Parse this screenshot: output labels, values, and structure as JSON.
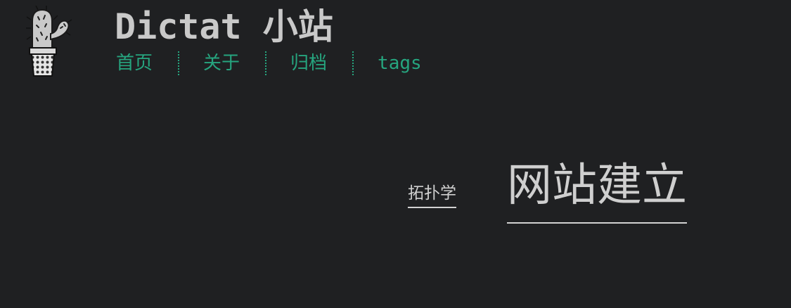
{
  "header": {
    "logo_icon": "cactus-pot-icon",
    "title": "Dictat 小站"
  },
  "nav": {
    "items": [
      {
        "label": "首页"
      },
      {
        "label": "关于"
      },
      {
        "label": "归档"
      },
      {
        "label": "tags"
      }
    ]
  },
  "tag_cloud": {
    "tags": [
      {
        "label": "拓扑学"
      },
      {
        "label": "网站建立"
      }
    ]
  },
  "colors": {
    "background": "#1f2022",
    "accent": "#26a57f",
    "text": "#c9c9c9"
  }
}
